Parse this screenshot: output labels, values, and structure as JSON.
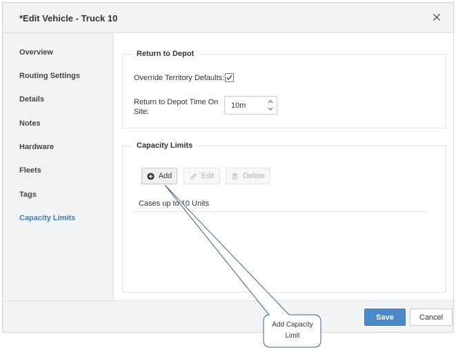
{
  "dialog": {
    "title": "*Edit Vehicle - Truck 10",
    "close_icon": "close-icon"
  },
  "sidebar": {
    "items": [
      {
        "label": "Overview",
        "active": false
      },
      {
        "label": "Routing Settings",
        "active": false
      },
      {
        "label": "Details",
        "active": false
      },
      {
        "label": "Notes",
        "active": false
      },
      {
        "label": "Hardware",
        "active": false
      },
      {
        "label": "Fleets",
        "active": false
      },
      {
        "label": "Tags",
        "active": false
      },
      {
        "label": "Capacity Limits",
        "active": true
      }
    ]
  },
  "return_to_depot": {
    "legend": "Return to Depot",
    "override_label": "Override Territory Defaults:",
    "override_checked": true,
    "time_label_line1": "Return to Depot Time On",
    "time_label_line2": "Site:",
    "time_value": "10m"
  },
  "capacity_limits": {
    "legend": "Capacity Limits",
    "add_label": "Add",
    "edit_label": "Edit",
    "delete_label": "Delete",
    "rows": [
      "Cases up to 10 Units"
    ]
  },
  "footer": {
    "save_label": "Save",
    "cancel_label": "Cancel"
  },
  "callout": {
    "line1": "Add Capacity",
    "line2": "Limit"
  },
  "colors": {
    "accent": "#4a89c8",
    "active_nav": "#3b7dbf",
    "panel_bg": "#f2f3f4"
  }
}
